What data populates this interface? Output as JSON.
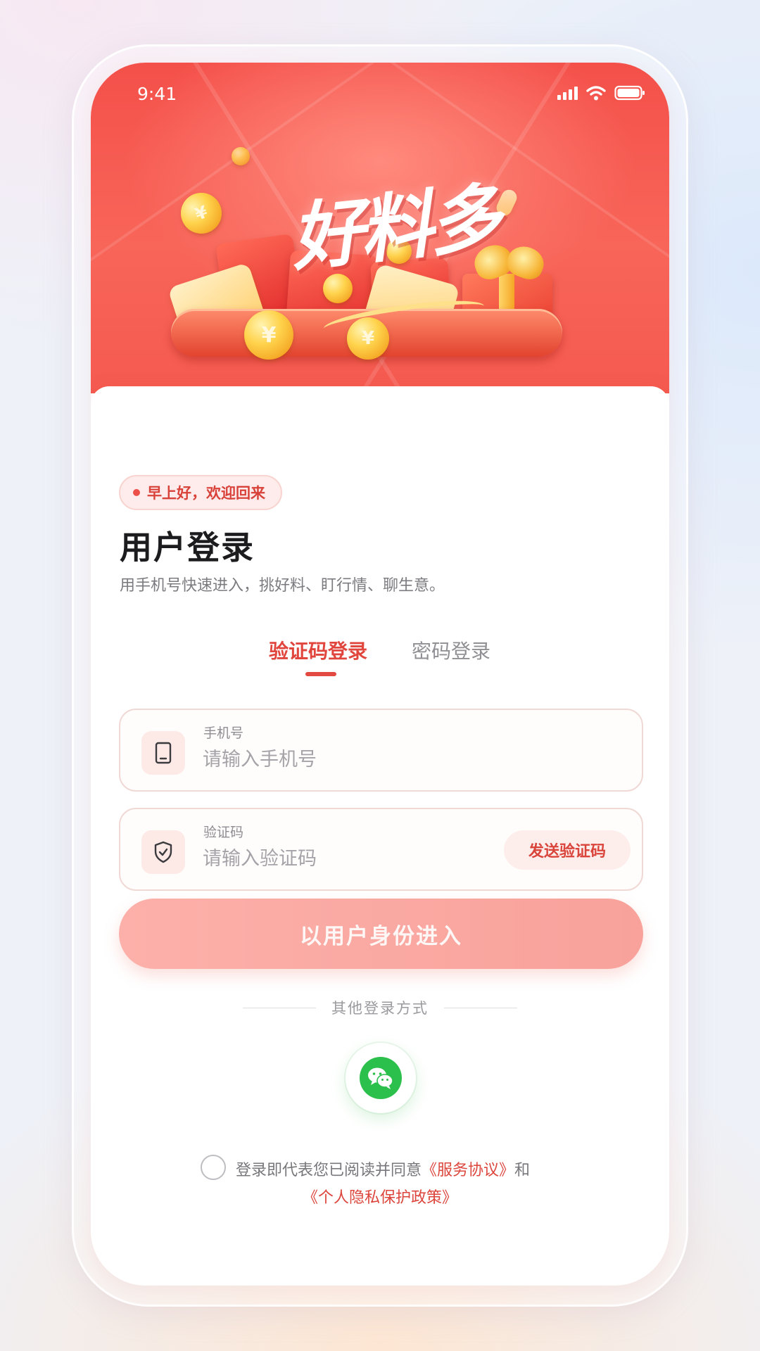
{
  "status_bar": {
    "time": "9:41"
  },
  "banner": {
    "title": "好料多"
  },
  "greeting": "早上好，欢迎回来",
  "page_title": "用户登录",
  "page_subtitle": "用手机号快速进入，挑好料、盯行情、聊生意。",
  "tabs": [
    {
      "label": "验证码登录",
      "active": true
    },
    {
      "label": "密码登录",
      "active": false
    }
  ],
  "phone_field": {
    "label": "手机号",
    "placeholder": "请输入手机号",
    "value": ""
  },
  "code_field": {
    "label": "验证码",
    "placeholder": "请输入验证码",
    "value": "",
    "send_label": "发送验证码"
  },
  "submit_label": "以用户身份进入",
  "other_login_label": "其他登录方式",
  "agreement": {
    "prefix": "登录即代表您已阅读并同意",
    "service_link": "《服务协议》",
    "conjunction": "和",
    "privacy_link": "《个人隐私保护政策》",
    "checked": false
  },
  "colors": {
    "accent": "#e0463d",
    "banner": "#f4504a",
    "submit_bg": "#fcb0a9",
    "wechat": "#2bbf4c"
  },
  "icons": {
    "phone": "mobile-phone-icon",
    "code": "shield-check-icon",
    "wechat": "wechat-icon"
  }
}
